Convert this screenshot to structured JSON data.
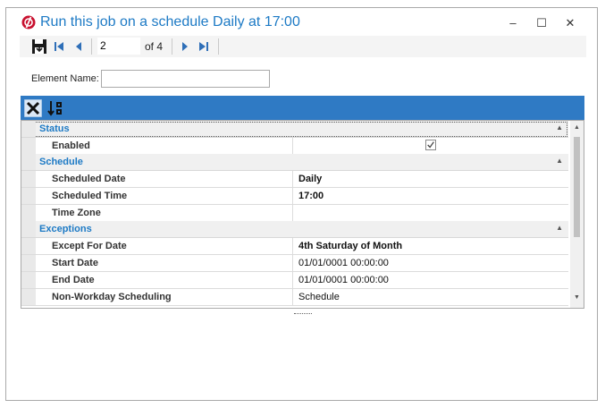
{
  "window": {
    "title": "Run this job on a schedule Daily at 17:00",
    "controls": {
      "minimize": "–",
      "maximize": "☐",
      "close": "✕"
    }
  },
  "nav": {
    "current_page": "2",
    "of_label": "of 4",
    "icons": [
      "save-icon",
      "first-record-icon",
      "previous-record-icon",
      "next-record-icon",
      "last-record-icon"
    ]
  },
  "element": {
    "label": "Element Name:",
    "value": ""
  },
  "grid_toolbar": {
    "icons": [
      "categorized-view-icon",
      "alphabetical-sort-icon"
    ]
  },
  "categories": [
    {
      "label": "Status",
      "props": [
        {
          "name": "Enabled",
          "value": "",
          "checked": true
        }
      ]
    },
    {
      "label": "Schedule",
      "props": [
        {
          "name": "Scheduled Date",
          "value": "Daily",
          "bold": true
        },
        {
          "name": "Scheduled Time",
          "value": "17:00",
          "bold": true
        },
        {
          "name": "Time Zone",
          "value": ""
        }
      ]
    },
    {
      "label": "Exceptions",
      "props": [
        {
          "name": "Except For Date",
          "value": "4th Saturday of Month",
          "bold": true
        },
        {
          "name": "Start Date",
          "value": "01/01/0001 00:00:00"
        },
        {
          "name": "End Date",
          "value": "01/01/0001 00:00:00"
        },
        {
          "name": "Non-Workday Scheduling",
          "value": "Schedule"
        }
      ]
    }
  ],
  "colors": {
    "accent": "#1d7ac5",
    "grid_toolbar_bg": "#2f7ac4"
  }
}
